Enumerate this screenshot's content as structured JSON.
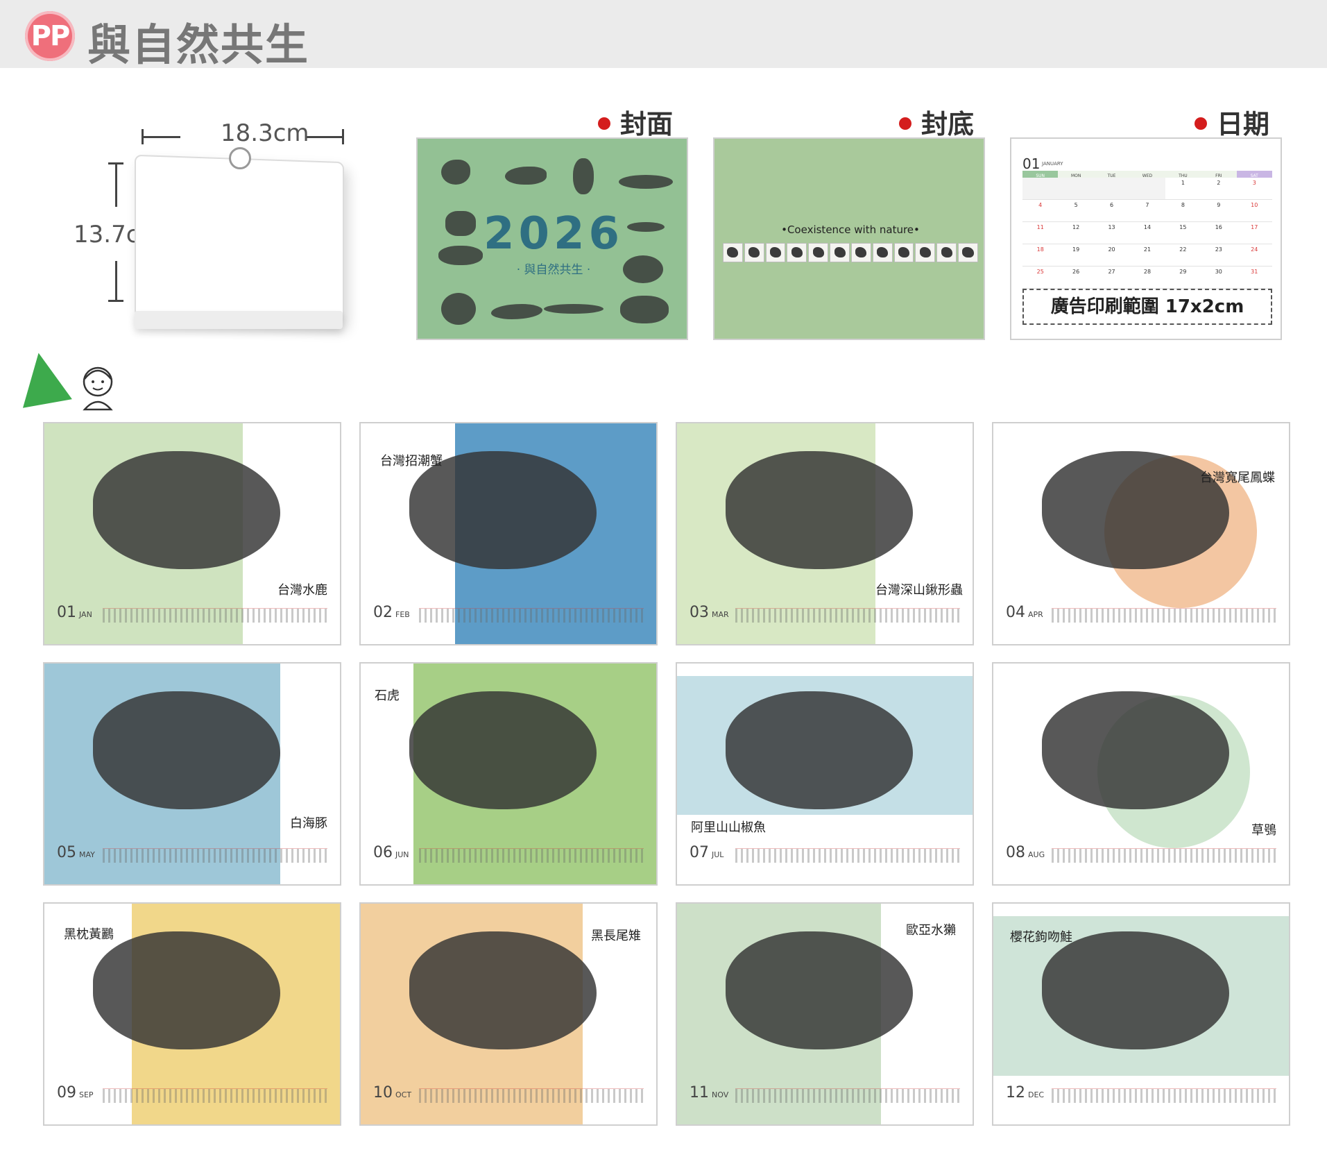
{
  "header": {
    "logo": "PP",
    "title": "與自然共生"
  },
  "product": {
    "width": "18.3cm",
    "height": "13.7cm"
  },
  "sections": {
    "cover": "封面",
    "back": "封底",
    "date": "日期"
  },
  "cover": {
    "year": "2026",
    "subtitle": "· 與自然共生 ·"
  },
  "back": {
    "caption": "•Coexistence with nature•",
    "thumbnails": 12
  },
  "date_page": {
    "month_number": "01",
    "month_name": "JANUARY",
    "weekdays": [
      "SUN",
      "MON",
      "TUE",
      "WED",
      "THU",
      "FRI",
      "SAT"
    ],
    "weeks": [
      [
        "",
        "",
        "",
        "",
        "1",
        "2",
        "3"
      ],
      [
        "4",
        "5",
        "6",
        "7",
        "8",
        "9",
        "10"
      ],
      [
        "11",
        "12",
        "13",
        "14",
        "15",
        "16",
        "17"
      ],
      [
        "18",
        "19",
        "20",
        "21",
        "22",
        "23",
        "24"
      ],
      [
        "25",
        "26",
        "27",
        "28",
        "29",
        "30",
        "31"
      ]
    ],
    "ad_area": "廣告印刷範圍 17x2cm"
  },
  "months": [
    {
      "num": "01",
      "abbr": "JAN",
      "name": "台灣水鹿",
      "bg": "#cfe3bf"
    },
    {
      "num": "02",
      "abbr": "FEB",
      "name": "台灣招潮蟹",
      "bg": "#5d9cc7"
    },
    {
      "num": "03",
      "abbr": "MAR",
      "name": "台灣深山鍬形蟲",
      "bg": "#d8e8c4"
    },
    {
      "num": "04",
      "abbr": "APR",
      "name": "台灣寬尾鳳蝶",
      "bg": "#f3c6a2"
    },
    {
      "num": "05",
      "abbr": "MAY",
      "name": "白海豚",
      "bg": "#9ec7d8"
    },
    {
      "num": "06",
      "abbr": "JUN",
      "name": "石虎",
      "bg": "#a7cf86"
    },
    {
      "num": "07",
      "abbr": "JUL",
      "name": "阿里山山椒魚",
      "bg": "#c4dfe6"
    },
    {
      "num": "08",
      "abbr": "AUG",
      "name": "草鴞",
      "bg": "#cfe6cf"
    },
    {
      "num": "09",
      "abbr": "SEP",
      "name": "黑枕黃鸝",
      "bg": "#f1d78a"
    },
    {
      "num": "10",
      "abbr": "OCT",
      "name": "黑長尾雉",
      "bg": "#f2cf9e"
    },
    {
      "num": "11",
      "abbr": "NOV",
      "name": "歐亞水獺",
      "bg": "#cde0c8"
    },
    {
      "num": "12",
      "abbr": "DEC",
      "name": "櫻花鉤吻鮭",
      "bg": "#cfe4d8"
    }
  ]
}
